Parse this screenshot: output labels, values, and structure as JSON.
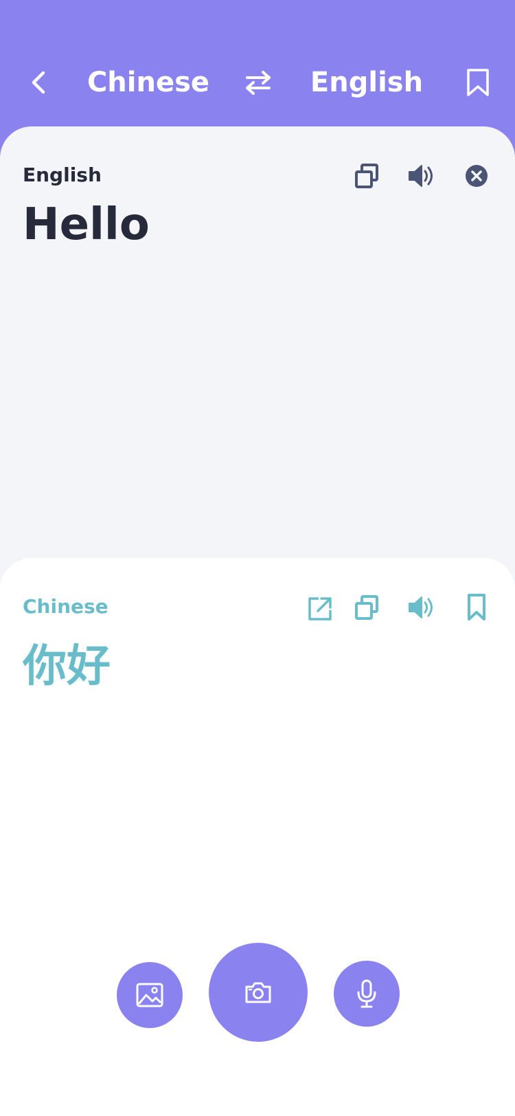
{
  "header": {
    "source_language": "Chinese",
    "target_language": "English",
    "background_color": "#8a82ef"
  },
  "source": {
    "language_label": "English",
    "text": "Hello",
    "icons": [
      "copy-icon",
      "speaker-icon",
      "clear-icon"
    ]
  },
  "result": {
    "language_label": "Chinese",
    "text": "你好",
    "accent_color": "#69bdcb",
    "icons": [
      "open-external-icon",
      "copy-icon",
      "speaker-icon",
      "bookmark-icon"
    ]
  },
  "bottom_bar": {
    "buttons": [
      "gallery-icon",
      "camera-icon",
      "microphone-icon"
    ]
  }
}
